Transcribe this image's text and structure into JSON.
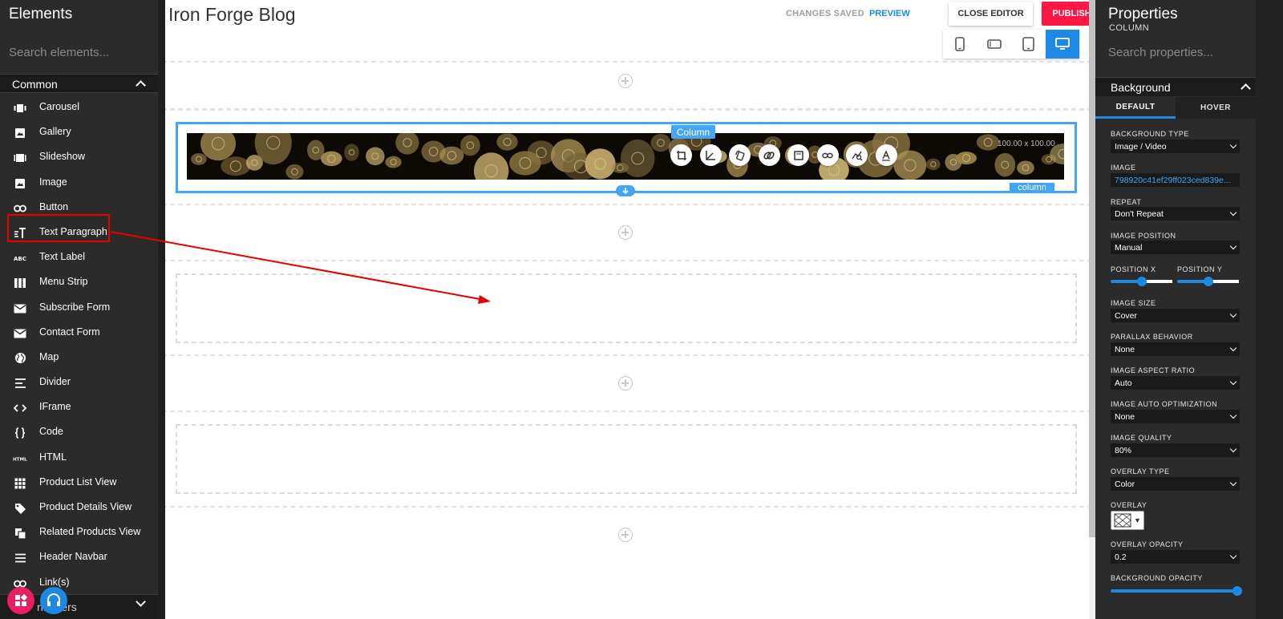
{
  "elements_panel": {
    "title": "Elements",
    "search_placeholder": "Search elements...",
    "section_label": "Common",
    "items": [
      {
        "label": "Carousel",
        "icon": "carousel-icon"
      },
      {
        "label": "Gallery",
        "icon": "gallery-icon"
      },
      {
        "label": "Slideshow",
        "icon": "slideshow-icon"
      },
      {
        "label": "Image",
        "icon": "image-icon"
      },
      {
        "label": "Button",
        "icon": "link-icon"
      },
      {
        "label": "Text Paragraph",
        "icon": "text-paragraph-icon"
      },
      {
        "label": "Text Label",
        "icon": "abc-icon"
      },
      {
        "label": "Menu Strip",
        "icon": "menu-strip-icon"
      },
      {
        "label": "Subscribe Form",
        "icon": "envelope-icon"
      },
      {
        "label": "Contact Form",
        "icon": "envelope-icon"
      },
      {
        "label": "Map",
        "icon": "globe-icon"
      },
      {
        "label": "Divider",
        "icon": "divider-icon"
      },
      {
        "label": "IFrame",
        "icon": "code-brackets-icon"
      },
      {
        "label": "Code",
        "icon": "curly-braces-icon"
      },
      {
        "label": "HTML",
        "icon": "html-icon"
      },
      {
        "label": "Product List View",
        "icon": "grid-icon"
      },
      {
        "label": "Product Details View",
        "icon": "tag-icon"
      },
      {
        "label": "Related Products View",
        "icon": "copy-icon"
      },
      {
        "label": "Header Navbar",
        "icon": "hamburger-icon"
      },
      {
        "label": "Link(s)",
        "icon": "link-icon"
      }
    ],
    "bottom_section_label": "ntainers"
  },
  "topbar": {
    "site_title": "Iron Forge Blog",
    "status": "CHANGES SAVED",
    "preview_label": "PREVIEW",
    "close_label": "CLOSE EDITOR",
    "publish_label": "PUBLISH",
    "devices": [
      "phone-portrait-icon",
      "phone-landscape-icon",
      "tablet-icon",
      "desktop-icon"
    ],
    "active_device": "desktop-icon"
  },
  "canvas": {
    "column_tag": "Column",
    "column_tag_bottom": "column",
    "dimensions": "100.00 x 100.00",
    "toolbar_icons": [
      "crop-icon",
      "angle-icon",
      "rotate-icon",
      "link-off-icon",
      "frame-icon",
      "link-icon",
      "image-search-icon",
      "text-icon"
    ]
  },
  "properties_panel": {
    "title": "Properties",
    "subtitle": "COLUMN",
    "search_placeholder": "Search properties...",
    "section_label": "Background",
    "tabs": [
      "DEFAULT",
      "HOVER"
    ],
    "active_tab": "DEFAULT",
    "fields": {
      "background_type": {
        "label": "BACKGROUND TYPE",
        "value": "Image / Video"
      },
      "image": {
        "label": "IMAGE",
        "value": "798920c41ef29ff023ced839e..."
      },
      "repeat": {
        "label": "REPEAT",
        "value": "Don't Repeat"
      },
      "image_position": {
        "label": "IMAGE POSITION",
        "value": "Manual"
      },
      "position_x": {
        "label": "POSITION X",
        "value": 0.5
      },
      "position_y": {
        "label": "POSITION Y",
        "value": 0.5
      },
      "image_size": {
        "label": "IMAGE SIZE",
        "value": "Cover"
      },
      "parallax": {
        "label": "PARALLAX BEHAVIOR",
        "value": "None"
      },
      "aspect_ratio": {
        "label": "IMAGE ASPECT RATIO",
        "value": "Auto"
      },
      "auto_optimization": {
        "label": "IMAGE AUTO OPTIMIZATION",
        "value": "None"
      },
      "quality": {
        "label": "IMAGE QUALITY",
        "value": "80%"
      },
      "overlay_type": {
        "label": "OVERLAY TYPE",
        "value": "Color"
      },
      "overlay": {
        "label": "OVERLAY"
      },
      "overlay_opacity": {
        "label": "OVERLAY OPACITY",
        "value": "0.2"
      },
      "background_opacity": {
        "label": "BACKGROUND OPACITY",
        "value": 1.0
      }
    }
  },
  "colors": {
    "accent": "#1e88e5",
    "publish": "#ff1744",
    "selection": "#42a5f5",
    "annotation": "#e60000",
    "panel_bg": "#2b2b2b"
  }
}
